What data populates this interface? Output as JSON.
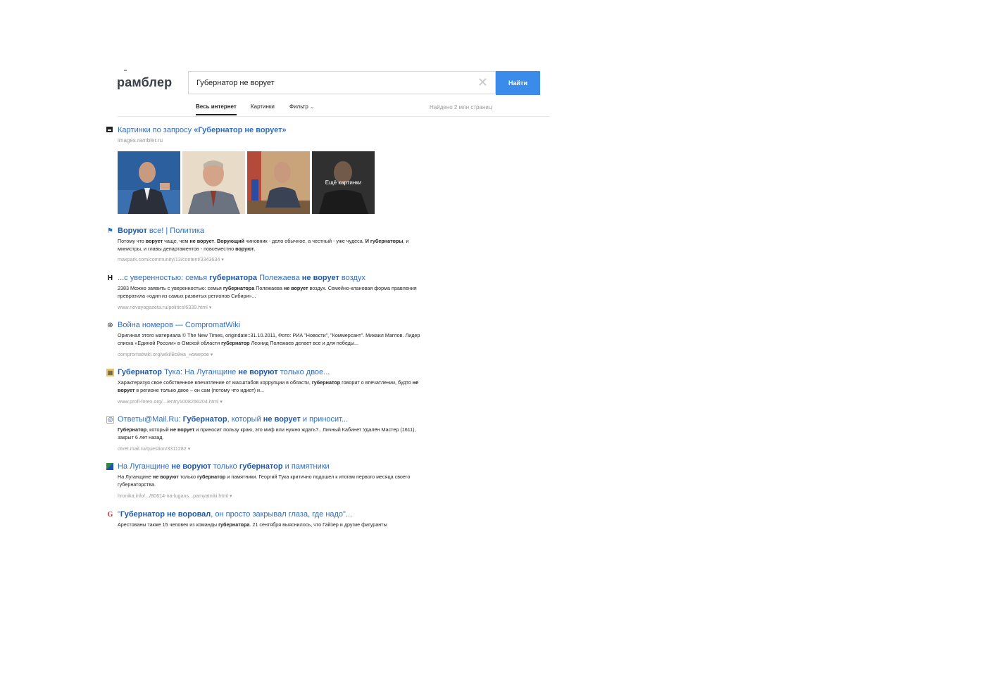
{
  "header": {
    "logo": "рамблер",
    "search_value": "Губернатор не ворует",
    "search_button": "Найти",
    "clear_icon": "close-icon"
  },
  "tabs": {
    "all": "Весь интернет",
    "images": "Картинки",
    "filter": "Фильтр",
    "found": "Найдено 2 млн страниц"
  },
  "images_block": {
    "title_prefix": "Картинки по запросу ",
    "title_query": "«Губернатор не ворует»",
    "source": "images.rambler.ru",
    "more": "Ещё картинки"
  },
  "results": [
    {
      "icon": "political-icon",
      "title_parts": [
        [
          "b",
          "Воруют"
        ],
        [
          "",
          "все! | Политика"
        ]
      ],
      "snippet_parts": [
        [
          "",
          "Потому что "
        ],
        [
          "b",
          "ворует"
        ],
        [
          "",
          "чаще, чем "
        ],
        [
          "b",
          "не ворует"
        ],
        [
          "",
          ". "
        ],
        [
          "b",
          "Ворующий"
        ],
        [
          "",
          "чиновник - дело обычное, а честный - уже чудеса. "
        ],
        [
          "b",
          "И губернаторы"
        ],
        [
          "",
          ", и министры, и главы департаментов - повсеместно "
        ],
        [
          "b",
          "воруют"
        ],
        [
          "",
          "."
        ]
      ],
      "url": "maxpark.com/community/13/content/3343634"
    },
    {
      "icon": "novaya-gazeta-icon",
      "title_parts": [
        [
          "",
          "...с уверенностью: семья "
        ],
        [
          "b",
          "губернатора"
        ],
        [
          "",
          "Полежаева "
        ],
        [
          "b",
          "не ворует"
        ],
        [
          "",
          "воздух"
        ]
      ],
      "snippet_parts": [
        [
          "",
          "2383 Можно заявить с уверенностью: семья "
        ],
        [
          "b",
          "губернатора"
        ],
        [
          "",
          "Полежаева "
        ],
        [
          "b",
          "не ворует"
        ],
        [
          "",
          "воздух. Семейно-клановая форма правления превратила «один из самых развитых регионов Сибири»..."
        ]
      ],
      "url": "www.novayagazeta.ru/politics/6339.html"
    },
    {
      "icon": "compromat-icon",
      "title_parts": [
        [
          "",
          "Война номеров — CompromatWiki"
        ]
      ],
      "snippet_parts": [
        [
          "",
          "Оригинал этого материала © The New Times, origindate::31.10.2011, Фото: РИА \"Новости\", \"Коммерсант\". Михаил Маглов. Лидер списка «Единой России» в Омской области "
        ],
        [
          "b",
          "губернатор"
        ],
        [
          "",
          "Леонид Полежаев делает все и для победы..."
        ]
      ],
      "url": "compromatwiki.org/wiki/Война_номеров"
    },
    {
      "icon": "forex-icon",
      "title_parts": [
        [
          "b",
          "Губернатор"
        ],
        [
          "",
          "Тука: На Луганщине "
        ],
        [
          "b",
          "не воруют"
        ],
        [
          "",
          "только двое..."
        ]
      ],
      "snippet_parts": [
        [
          "",
          "Характеризуя свое собственное впечатление от масштабов коррупции в области, "
        ],
        [
          "b",
          "губернатор"
        ],
        [
          "",
          "говорит о впечатлении, будто "
        ],
        [
          "b",
          "не ворует"
        ],
        [
          "",
          "в регионе только двое – он сам (потому что идиот) и..."
        ]
      ],
      "url": "www.profi-forex.org/.../entry1008266204.html"
    },
    {
      "icon": "mail-answers-icon",
      "title_parts": [
        [
          "",
          "Ответы@Mail.Ru: "
        ],
        [
          "b",
          "Губернатор"
        ],
        [
          "",
          ", который "
        ],
        [
          "b",
          "не ворует"
        ],
        [
          "",
          "и приносит..."
        ]
      ],
      "snippet_parts": [
        [
          "b",
          "Губернатор"
        ],
        [
          "",
          ", который "
        ],
        [
          "b",
          "не ворует"
        ],
        [
          "",
          "и приносит пользу краю, это миф или нужно ждать?.. Личный Кабинет Удалён Мастер (1611), закрыт 6 лет назад."
        ]
      ],
      "url": "otvet.mail.ru/question/3311282"
    },
    {
      "icon": "hronika-icon",
      "title_parts": [
        [
          "",
          "На Луганщине "
        ],
        [
          "b",
          "не воруют"
        ],
        [
          "",
          "только "
        ],
        [
          "b",
          "губернатор"
        ],
        [
          "",
          "и памятники"
        ]
      ],
      "snippet_parts": [
        [
          "",
          "На Луганщине "
        ],
        [
          "b",
          "не воруют"
        ],
        [
          "",
          "только "
        ],
        [
          "b",
          "губернатор"
        ],
        [
          "",
          "и памятники. Георгий Тука критично подошел к итогам первого месяца своего губернаторства."
        ]
      ],
      "url": "hronika.info/.../80614-na-lugans...pamyatniki.html"
    },
    {
      "icon": "g-news-icon",
      "title_parts": [
        [
          "",
          "\""
        ],
        [
          "b",
          "Губернатор не воровал"
        ],
        [
          "",
          ", он просто закрывал глаза, где надо\"..."
        ]
      ],
      "snippet_parts": [
        [
          "",
          "Арестованы также 15 человек из команды "
        ],
        [
          "b",
          "губернатора"
        ],
        [
          "",
          ". 21 сентября выяснилось, что Гайзер и другие фигуранты"
        ]
      ],
      "url": ""
    }
  ]
}
